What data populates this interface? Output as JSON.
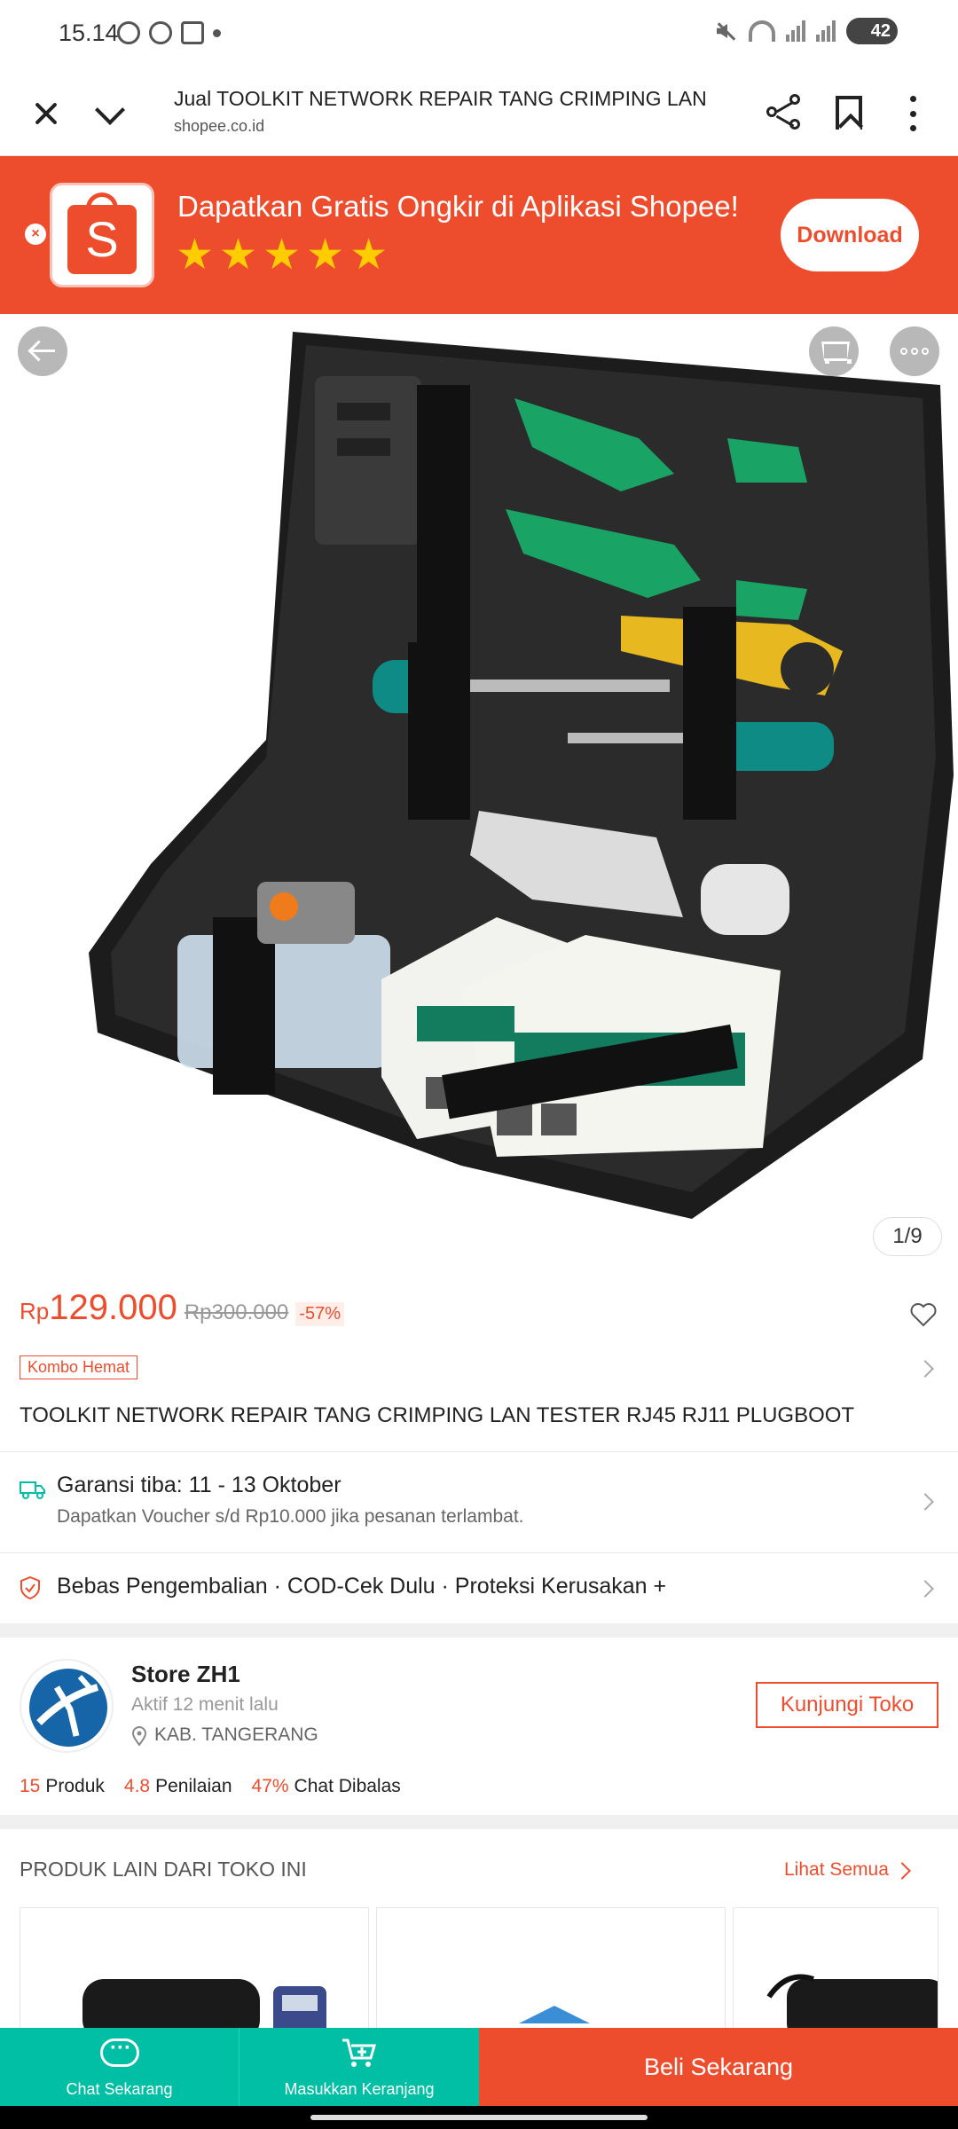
{
  "status_bar": {
    "time": "15.14",
    "battery": "42"
  },
  "browser": {
    "page_title": "Jual TOOLKIT NETWORK REPAIR TANG CRIMPING LAN ...",
    "domain": "shopee.co.id"
  },
  "app_banner": {
    "close_label": "×",
    "logo_letter": "S",
    "text": "Dapatkan Gratis Ongkir di Aplikasi Shopee!",
    "rating_stars": 5,
    "download_label": "Download",
    "brand_color": "#ee4d2d"
  },
  "product": {
    "image_counter": "1/9",
    "currency": "Rp",
    "price": "129.000",
    "old_price": "Rp300.000",
    "discount": "-57%",
    "tag": "Kombo Hemat",
    "title": "TOOLKIT NETWORK REPAIR TANG CRIMPING LAN TESTER RJ45 RJ11 PLUGBOOT"
  },
  "shipping": {
    "title": "Garansi tiba: 11 - 13 Oktober",
    "subtitle": "Dapatkan Voucher s/d Rp10.000 jika pesanan terlambat."
  },
  "returns": {
    "text": "Bebas Pengembalian · COD-Cek Dulu · Proteksi Kerusakan +"
  },
  "store": {
    "name": "Store ZH1",
    "active": "Aktif 12 menit lalu",
    "location": "KAB. TANGERANG",
    "visit_label": "Kunjungi Toko",
    "stats": [
      {
        "num": "15",
        "label": "Produk"
      },
      {
        "num": "4.8",
        "label": "Penilaian"
      },
      {
        "num": "47%",
        "label": "Chat Dibalas"
      }
    ]
  },
  "other_products": {
    "header": "PRODUK LAIN DARI TOKO INI",
    "see_all": "Lihat Semua"
  },
  "bottom_bar": {
    "chat_label": "Chat Sekarang",
    "cart_label": "Masukkan Keranjang",
    "buy_label": "Beli Sekarang",
    "accent_color": "#00bfa5"
  }
}
